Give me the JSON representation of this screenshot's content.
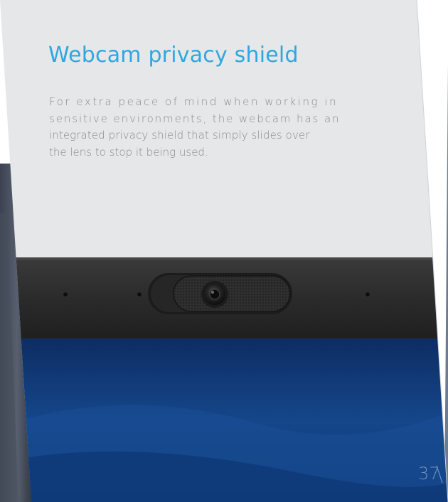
{
  "heading": "Webcam privacy shield",
  "body_lines": [
    "For extra peace of mind when working in",
    "sensitive environments, the webcam has an",
    "integrated privacy shield that simply slides over",
    "the lens to stop it being used."
  ],
  "page_number": "37",
  "colors": {
    "heading": "#2ea7e0",
    "body_text": "#8a8a8a",
    "panel": "#e6e7e9",
    "bezel": "#2a2a2a",
    "screen": "#103a78"
  },
  "illustration": {
    "subject": "laptop bezel with webcam privacy shield slid beside the lens",
    "icons": [
      "webcam-lens-icon",
      "privacy-shield-icon"
    ]
  }
}
